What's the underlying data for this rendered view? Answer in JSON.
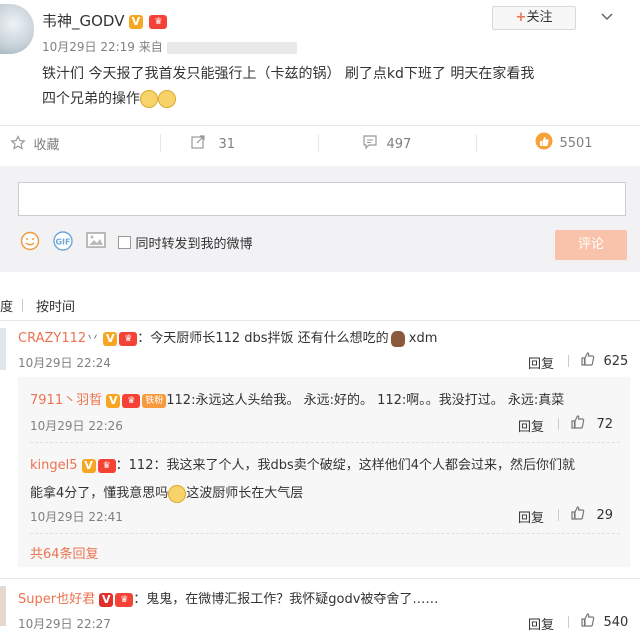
{
  "post": {
    "author": "韦神_GODV",
    "follow_label": "关注",
    "time": "10月29日 22:19",
    "source_prefix": "来自",
    "text_line1": "铁汁们 今天报了我首发只能强行上（卡兹的锅） 刷了点kd下班了 明天在家看我",
    "text_line2": "四个兄弟的操作",
    "actions": {
      "favorite": "收藏",
      "repost_count": "31",
      "comment_count": "497",
      "like_count": "5501"
    }
  },
  "composer": {
    "placeholder": "",
    "also_repost_label": "同时转发到我的微博",
    "submit_label": "评论"
  },
  "sort": {
    "left_partial": "度",
    "by_time": "按时间"
  },
  "comments": [
    {
      "user": "CRAZY112",
      "user_suffix": "丷",
      "text": "：今天厨师长112 dbs拌饭 还有什么想吃的",
      "text_after": " xdm",
      "time": "10月29日 22:24",
      "reply_label": "回复",
      "likes": "625",
      "replies": [
        {
          "user": "7911丶羽晢",
          "fan_badge": "铁粉",
          "text": "112:永远这人头给我。 永远:好的。 112:啊。。我没打过。 永远:真菜",
          "time": "10月29日 22:26",
          "reply_label": "回复",
          "likes": "72"
        },
        {
          "user": "kingel5",
          "text_line1": "：112：我这来了个人，我dbs卖个破绽，这样他们4个人都会过来，然后你们就",
          "text_line2a": "能拿4分了，懂我意思吗",
          "text_line2b": "这波厨师长在大气层",
          "time": "10月29日 22:41",
          "reply_label": "回复",
          "likes": "29"
        }
      ],
      "more_replies": "共64条回复"
    },
    {
      "user": "Super也好君",
      "text": "：鬼鬼，在微博汇报工作？我怀疑godv被夺舍了……",
      "time": "10月29日 22:27",
      "reply_label": "回复",
      "likes": "540"
    }
  ]
}
